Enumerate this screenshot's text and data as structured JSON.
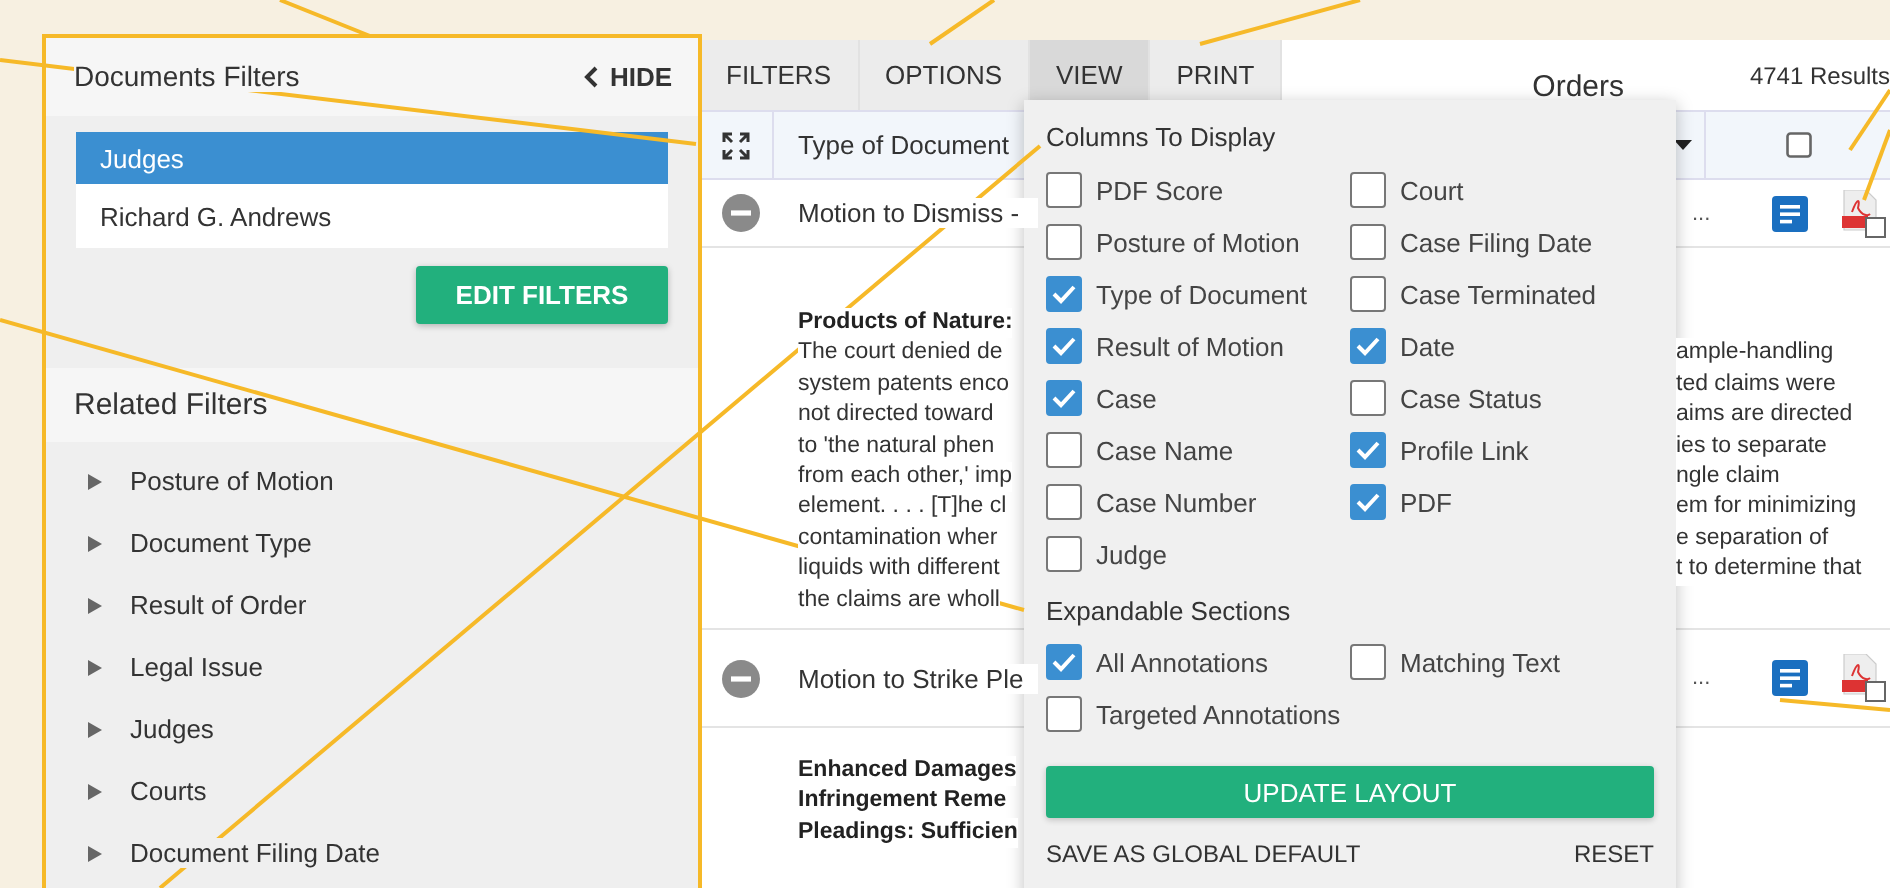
{
  "sidebar": {
    "title": "Documents Filters",
    "hide_label": "HIDE",
    "active_filters": [
      {
        "label": "Judges",
        "selected": true
      },
      {
        "label": "Richard G. Andrews",
        "selected": false
      }
    ],
    "edit_button": "EDIT FILTERS",
    "related_title": "Related Filters",
    "related_items": [
      {
        "label": "Posture of Motion",
        "expanded": false
      },
      {
        "label": "Document Type",
        "expanded": false
      },
      {
        "label": "Result of Order",
        "expanded": false
      },
      {
        "label": "Legal Issue",
        "expanded": false
      },
      {
        "label": "Judges",
        "expanded": false
      },
      {
        "label": "Courts",
        "expanded": false
      },
      {
        "label": "Document Filing Date",
        "expanded": false
      }
    ]
  },
  "toolbar": {
    "tabs": [
      {
        "label": "FILTERS",
        "selected": false
      },
      {
        "label": "OPTIONS",
        "selected": false
      },
      {
        "label": "VIEW",
        "selected": true
      },
      {
        "label": "PRINT",
        "selected": false
      }
    ],
    "title": "Orders",
    "results": "4741 Results"
  },
  "table": {
    "column_header": "Type of Document",
    "rows": [
      {
        "kind": "document",
        "title": "Motion to Dismiss -",
        "ellipsis": "..."
      },
      {
        "kind": "summary",
        "heading_lines": [
          "Products of Nature:"
        ],
        "left_lines": [
          "The court denied de",
          "system patents enco",
          "not directed toward",
          "to 'the natural phen",
          "from each other,' imp",
          "element. . . . [T]he cl",
          "contamination wher",
          "liquids with different",
          "the claims are wholl"
        ],
        "right_lines": [
          "ample-handling",
          "ted claims were",
          "aims are directed",
          "ies to separate",
          "ngle claim",
          "em for minimizing",
          "e separation of",
          "t to determine that"
        ]
      },
      {
        "kind": "document",
        "title": "Motion to Strike Ple",
        "ellipsis": "..."
      },
      {
        "kind": "summary",
        "heading_lines": [
          "Enhanced Damages",
          "Infringement Reme",
          "Pleadings: Sufficien"
        ],
        "left_lines": [],
        "right_lines": []
      }
    ]
  },
  "view_menu": {
    "columns_title": "Columns To Display",
    "columns_left": [
      {
        "label": "PDF Score",
        "checked": false
      },
      {
        "label": "Posture of Motion",
        "checked": false
      },
      {
        "label": "Type of Document",
        "checked": true
      },
      {
        "label": "Result of Motion",
        "checked": true
      },
      {
        "label": "Case",
        "checked": true
      },
      {
        "label": "Case Name",
        "checked": false
      },
      {
        "label": "Case Number",
        "checked": false
      },
      {
        "label": "Judge",
        "checked": false
      }
    ],
    "columns_right": [
      {
        "label": "Court",
        "checked": false
      },
      {
        "label": "Case Filing Date",
        "checked": false
      },
      {
        "label": "Case Terminated",
        "checked": false
      },
      {
        "label": "Date",
        "checked": true
      },
      {
        "label": "Case Status",
        "checked": false
      },
      {
        "label": "Profile Link",
        "checked": true
      },
      {
        "label": "PDF",
        "checked": true
      }
    ],
    "sections_title": "Expandable Sections",
    "sections": [
      {
        "label": "All Annotations",
        "checked": true
      },
      {
        "label": "Matching Text",
        "checked": false
      },
      {
        "label": "Targeted Annotations",
        "checked": false
      }
    ],
    "update_button": "UPDATE LAYOUT",
    "save_default": "SAVE AS GLOBAL DEFAULT",
    "reset": "RESET"
  }
}
